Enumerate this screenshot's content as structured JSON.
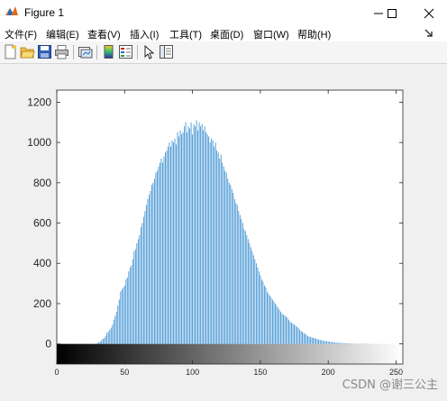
{
  "window": {
    "title": "Figure 1",
    "minimize_glyph": "minimize-icon",
    "maximize_glyph": "maximize-icon",
    "close_glyph": "close-icon"
  },
  "menu": [
    "文件(F)",
    "编辑(E)",
    "查看(V)",
    "插入(I)",
    "工具(T)",
    "桌面(D)",
    "窗口(W)",
    "帮助(H)"
  ],
  "toolbar": {
    "icons": [
      "new-figure-icon",
      "open-file-icon",
      "save-icon",
      "print-icon",
      "link-plot-icon",
      "colorbar-icon",
      "legend-icon",
      "edit-plot-icon",
      "property-inspector-icon"
    ]
  },
  "colors": {
    "bar": "#3a8fd1",
    "axes_bg": "#ffffff",
    "figure_bg": "#f0f0f0"
  },
  "chart_data": {
    "type": "bar",
    "title": "",
    "xlabel": "",
    "ylabel": "",
    "xlim": [
      0,
      255
    ],
    "ylim": [
      -100,
      1260
    ],
    "yticks": [
      0,
      200,
      400,
      600,
      800,
      1000,
      1200
    ],
    "xticks": [
      0,
      50,
      100,
      150,
      200,
      250
    ],
    "colorbar": "grayscale 0 to 255",
    "histogram": {
      "x": [
        0,
        1,
        2,
        3,
        4,
        5,
        6,
        7,
        8,
        9,
        10,
        11,
        12,
        13,
        14,
        15,
        16,
        17,
        18,
        19,
        20,
        21,
        22,
        23,
        24,
        25,
        26,
        27,
        28,
        29,
        30,
        31,
        32,
        33,
        34,
        35,
        36,
        37,
        38,
        39,
        40,
        41,
        42,
        43,
        44,
        45,
        46,
        47,
        48,
        49,
        50,
        51,
        52,
        53,
        54,
        55,
        56,
        57,
        58,
        59,
        60,
        61,
        62,
        63,
        64,
        65,
        66,
        67,
        68,
        69,
        70,
        71,
        72,
        73,
        74,
        75,
        76,
        77,
        78,
        79,
        80,
        81,
        82,
        83,
        84,
        85,
        86,
        87,
        88,
        89,
        90,
        91,
        92,
        93,
        94,
        95,
        96,
        97,
        98,
        99,
        100,
        101,
        102,
        103,
        104,
        105,
        106,
        107,
        108,
        109,
        110,
        111,
        112,
        113,
        114,
        115,
        116,
        117,
        118,
        119,
        120,
        121,
        122,
        123,
        124,
        125,
        126,
        127,
        128,
        129,
        130,
        131,
        132,
        133,
        134,
        135,
        136,
        137,
        138,
        139,
        140,
        141,
        142,
        143,
        144,
        145,
        146,
        147,
        148,
        149,
        150,
        151,
        152,
        153,
        154,
        155,
        156,
        157,
        158,
        159,
        160,
        161,
        162,
        163,
        164,
        165,
        166,
        167,
        168,
        169,
        170,
        171,
        172,
        173,
        174,
        175,
        176,
        177,
        178,
        179,
        180,
        181,
        182,
        183,
        184,
        185,
        186,
        187,
        188,
        189,
        190,
        191,
        192,
        193,
        194,
        195,
        196,
        197,
        198,
        199,
        200,
        201,
        202,
        203,
        204,
        205,
        206,
        207,
        208,
        209,
        210,
        211,
        212,
        213,
        214,
        215,
        216,
        217,
        218,
        219,
        220,
        221,
        222,
        223,
        224,
        225,
        226,
        227,
        228,
        229,
        230,
        231,
        232,
        233,
        234,
        235,
        236,
        237,
        238,
        239,
        240,
        241,
        242,
        243,
        244,
        245,
        246,
        247,
        248,
        249,
        250,
        251,
        252,
        253,
        254,
        255
      ],
      "values": [
        0,
        0,
        0,
        0,
        0,
        0,
        0,
        0,
        0,
        0,
        0,
        0,
        0,
        0,
        0,
        0,
        0,
        0,
        0,
        0,
        0,
        0,
        0,
        0,
        0,
        0,
        0,
        0,
        0,
        0,
        5,
        8,
        12,
        18,
        25,
        30,
        40,
        55,
        60,
        70,
        80,
        95,
        120,
        140,
        160,
        190,
        220,
        260,
        270,
        280,
        290,
        320,
        330,
        360,
        380,
        390,
        420,
        460,
        470,
        500,
        520,
        540,
        580,
        600,
        630,
        660,
        690,
        720,
        740,
        760,
        790,
        800,
        820,
        850,
        860,
        880,
        900,
        920,
        900,
        930,
        950,
        960,
        980,
        1000,
        980,
        1010,
        1000,
        1020,
        990,
        1050,
        1030,
        1060,
        1040,
        1050,
        1080,
        1100,
        1050,
        1080,
        1070,
        1100,
        1040,
        1090,
        1080,
        1110,
        1060,
        1100,
        1080,
        1090,
        1060,
        1080,
        1050,
        1040,
        1030,
        1000,
        1020,
        1010,
        980,
        1000,
        960,
        950,
        920,
        940,
        900,
        880,
        860,
        850,
        820,
        800,
        790,
        770,
        750,
        720,
        700,
        690,
        660,
        640,
        620,
        600,
        570,
        560,
        540,
        520,
        500,
        480,
        460,
        440,
        420,
        400,
        380,
        360,
        340,
        320,
        310,
        290,
        280,
        260,
        250,
        240,
        230,
        220,
        210,
        200,
        190,
        180,
        170,
        160,
        150,
        145,
        140,
        135,
        130,
        120,
        110,
        105,
        100,
        95,
        90,
        85,
        80,
        70,
        65,
        60,
        55,
        50,
        45,
        40,
        36,
        34,
        32,
        30,
        28,
        26,
        24,
        22,
        20,
        18,
        16,
        15,
        14,
        13,
        12,
        11,
        10,
        9,
        8,
        7,
        6,
        6,
        5,
        5,
        4,
        4,
        3,
        3,
        3,
        2,
        2,
        2,
        2,
        1,
        1,
        1,
        1,
        1,
        1,
        1,
        1,
        1,
        1,
        1,
        0,
        0,
        0,
        0,
        0,
        0,
        0,
        0,
        0,
        0,
        0,
        0,
        0,
        0,
        0,
        0,
        0,
        0,
        0,
        0,
        0,
        0,
        0,
        0,
        0,
        0,
        0
      ]
    }
  },
  "watermark": "CSDN @谢三公主"
}
